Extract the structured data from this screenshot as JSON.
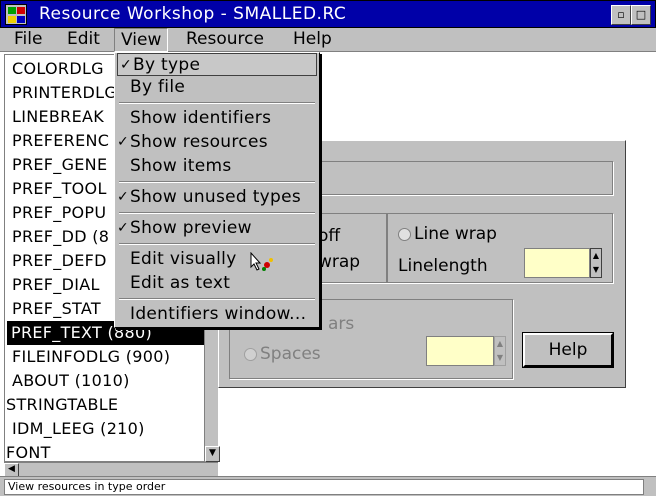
{
  "window": {
    "title": "Resource Workshop - SMALLED.RC",
    "minimize_glyph": "▫",
    "maximize_glyph": "□"
  },
  "menubar": {
    "items": [
      "File",
      "Edit",
      "View",
      "Resource",
      "Help"
    ]
  },
  "resource_list": {
    "items": [
      "COLORDLG",
      "PRINTERDLG",
      "LINEBREAK",
      "PREFERENC",
      "PREF_GENE",
      "PREF_TOOL",
      "PREF_POPU",
      "PREF_DD (8",
      "PREF_DEFD",
      "PREF_DIAL",
      "PREF_STAT",
      "PREF_TEXT (880)",
      "FILEINFODLG (900)",
      "ABOUT (1010)",
      "STRINGTABLE",
      "IDM_LEEG (210)",
      "FONT"
    ],
    "selected_index": 11,
    "scroll_down_glyph": "▼",
    "scroll_left_glyph": "◀"
  },
  "view_menu": {
    "items": [
      {
        "label": "By type",
        "checked": true,
        "highlighted": true
      },
      {
        "label": "By file",
        "checked": false
      },
      {
        "label": "Show identifiers",
        "checked": false
      },
      {
        "label": "Show resources",
        "checked": true
      },
      {
        "label": "Show items",
        "checked": false
      },
      {
        "label": "Show unused types",
        "checked": true
      },
      {
        "label": "Show preview",
        "checked": true
      },
      {
        "label": "Edit visually",
        "checked": false
      },
      {
        "label": "Edit as text",
        "checked": false
      },
      {
        "label": "Identifiers window...",
        "checked": false
      }
    ],
    "check_glyph": "✓"
  },
  "preview": {
    "off_label": "off",
    "wrap_label": "wrap",
    "line_wrap_label": "Line wrap",
    "linelength_label": "Linelength",
    "chars_label": "ars",
    "spaces_label": "Spaces",
    "help_label": "Help",
    "spin_up": "▲",
    "spin_down": "▼"
  },
  "statusbar": {
    "text": "View resources in type order"
  }
}
